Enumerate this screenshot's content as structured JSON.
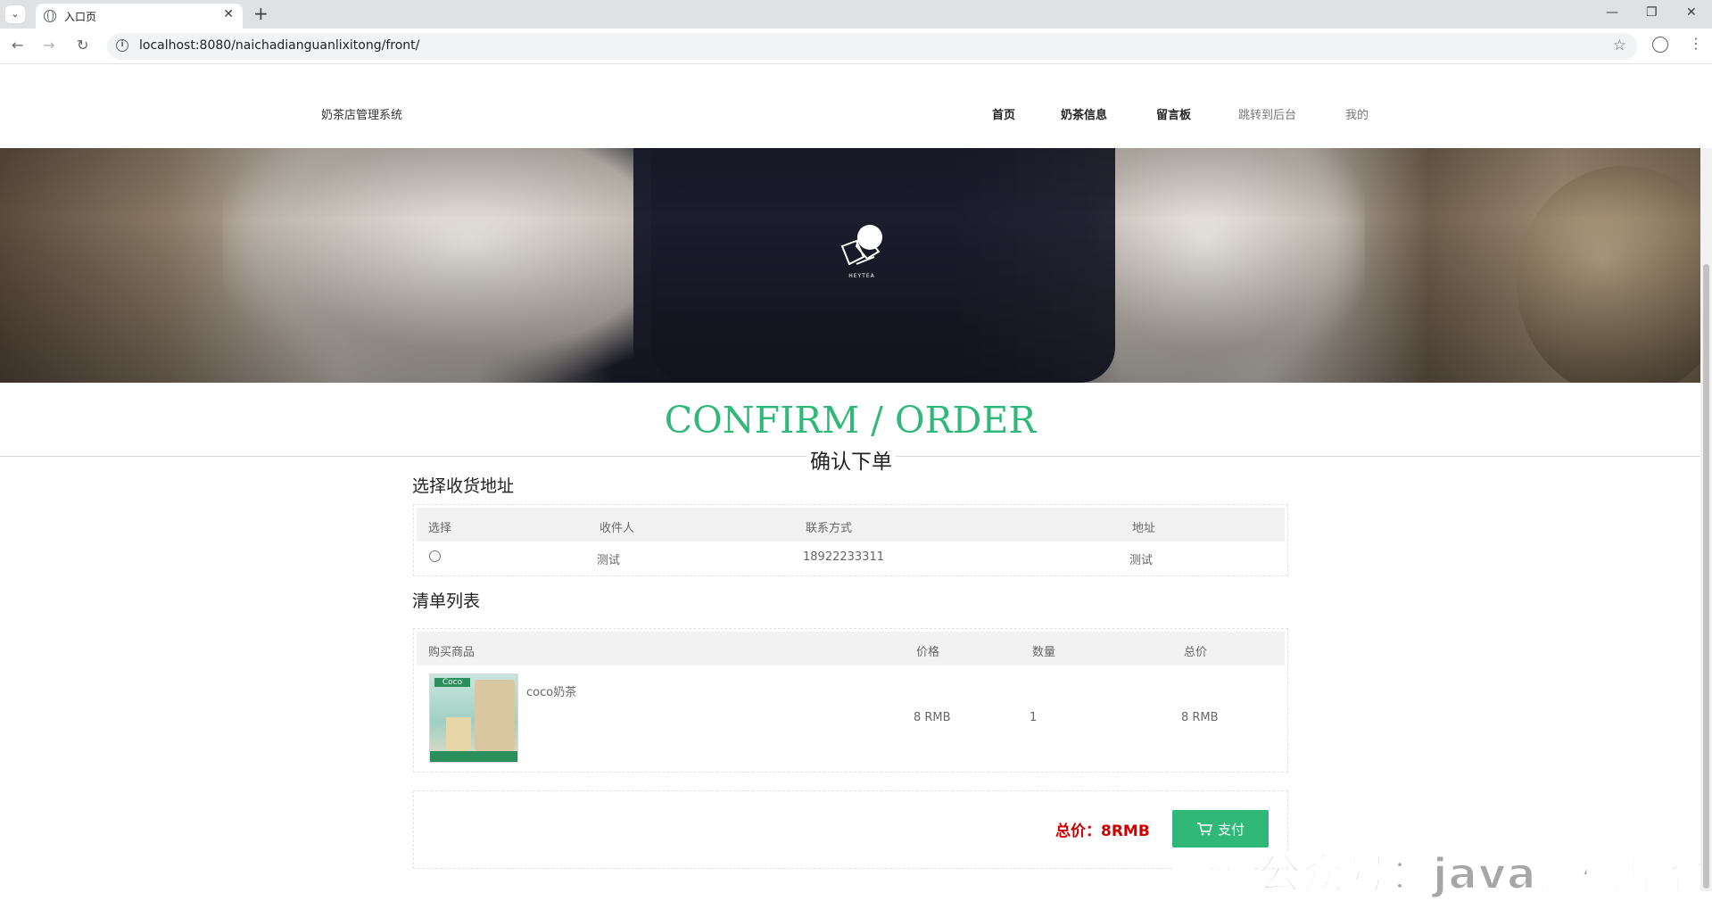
{
  "browser": {
    "tab_title": "入口页",
    "url": "localhost:8080/naichadianguanlixitong/front/"
  },
  "site": {
    "logo": "奶茶店管理系统",
    "nav": [
      {
        "label": "首页",
        "active": true
      },
      {
        "label": "奶茶信息",
        "active": true
      },
      {
        "label": "留言板",
        "active": true
      },
      {
        "label": "跳转到后台",
        "active": false
      },
      {
        "label": "我的",
        "active": false
      }
    ]
  },
  "hero": {
    "brand": "HEYTEA"
  },
  "page": {
    "title_en": "CONFIRM / ORDER",
    "title_cn": "确认下单"
  },
  "address_section": {
    "title": "选择收货地址",
    "headers": [
      "选择",
      "收件人",
      "联系方式",
      "地址"
    ],
    "rows": [
      {
        "name": "测试",
        "phone": "18922233311",
        "address": "测试"
      }
    ]
  },
  "list_section": {
    "title": "清单列表",
    "headers": [
      "购买商品",
      "价格",
      "数量",
      "总价"
    ],
    "items": [
      {
        "name": "coco奶茶",
        "price": "8 RMB",
        "qty": "1",
        "total": "8 RMB"
      }
    ]
  },
  "summary": {
    "total_label": "总价：8RMB",
    "pay_label": "支付"
  },
  "watermark": "微信公众号：java源码集合",
  "colors": {
    "accent": "#2fb878",
    "total": "#cc0000"
  }
}
